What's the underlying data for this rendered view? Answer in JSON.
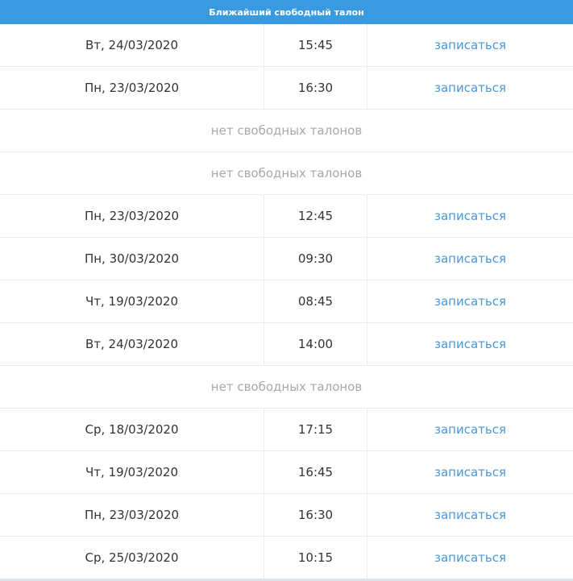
{
  "header": {
    "title": "Ближайший свободный талон"
  },
  "rows": [
    {
      "type": "slot",
      "date": "Вт, 24/03/2020",
      "time": "15:45",
      "action": "записаться"
    },
    {
      "type": "slot",
      "date": "Пн, 23/03/2020",
      "time": "16:30",
      "action": "записаться"
    },
    {
      "type": "empty",
      "text": "нет свободных талонов"
    },
    {
      "type": "empty",
      "text": "нет свободных талонов"
    },
    {
      "type": "slot",
      "date": "Пн, 23/03/2020",
      "time": "12:45",
      "action": "записаться"
    },
    {
      "type": "slot",
      "date": "Пн, 30/03/2020",
      "time": "09:30",
      "action": "записаться"
    },
    {
      "type": "slot",
      "date": "Чт, 19/03/2020",
      "time": "08:45",
      "action": "записаться"
    },
    {
      "type": "slot",
      "date": "Вт, 24/03/2020",
      "time": "14:00",
      "action": "записаться"
    },
    {
      "type": "empty",
      "text": "нет свободных талонов"
    },
    {
      "type": "slot",
      "date": "Ср, 18/03/2020",
      "time": "17:15",
      "action": "записаться"
    },
    {
      "type": "slot",
      "date": "Чт, 19/03/2020",
      "time": "16:45",
      "action": "записаться"
    },
    {
      "type": "slot",
      "date": "Пн, 23/03/2020",
      "time": "16:30",
      "action": "записаться"
    },
    {
      "type": "slot",
      "date": "Ср, 25/03/2020",
      "time": "10:15",
      "action": "записаться"
    }
  ],
  "colors": {
    "header_bg": "#3a9ae0",
    "link": "#4a97d8",
    "muted": "#a8a8a8",
    "text": "#333333"
  }
}
